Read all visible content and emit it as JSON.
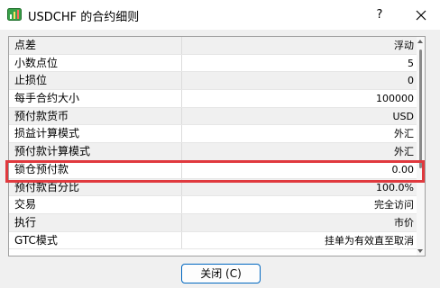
{
  "window": {
    "title": "USDCHF 的合约细则",
    "help_label": "?",
    "close_icon": "close-icon",
    "app_icon": "mt-terminal-icon"
  },
  "spec": {
    "rows": [
      {
        "name": "点差",
        "value": "浮动"
      },
      {
        "name": "小数点位",
        "value": "5"
      },
      {
        "name": "止损位",
        "value": "0"
      },
      {
        "name": "每手合约大小",
        "value": "100000"
      },
      {
        "name": "预付款货币",
        "value": "USD"
      },
      {
        "name": "损益计算模式",
        "value": "外汇"
      },
      {
        "name": "预付款计算模式",
        "value": "外汇"
      },
      {
        "name": "锁仓预付款",
        "value": "0.00"
      },
      {
        "name": "预付款百分比",
        "value": "100.0%"
      },
      {
        "name": "交易",
        "value": "完全访问"
      },
      {
        "name": "执行",
        "value": "市价"
      },
      {
        "name": "GTC模式",
        "value": "挂单为有效直至取消"
      }
    ],
    "highlighted_row": "锁仓预付款"
  },
  "footer": {
    "close_button_label": "关闭 (C)"
  },
  "colors": {
    "highlight": "#e0393e",
    "button_border": "#0067c0"
  }
}
